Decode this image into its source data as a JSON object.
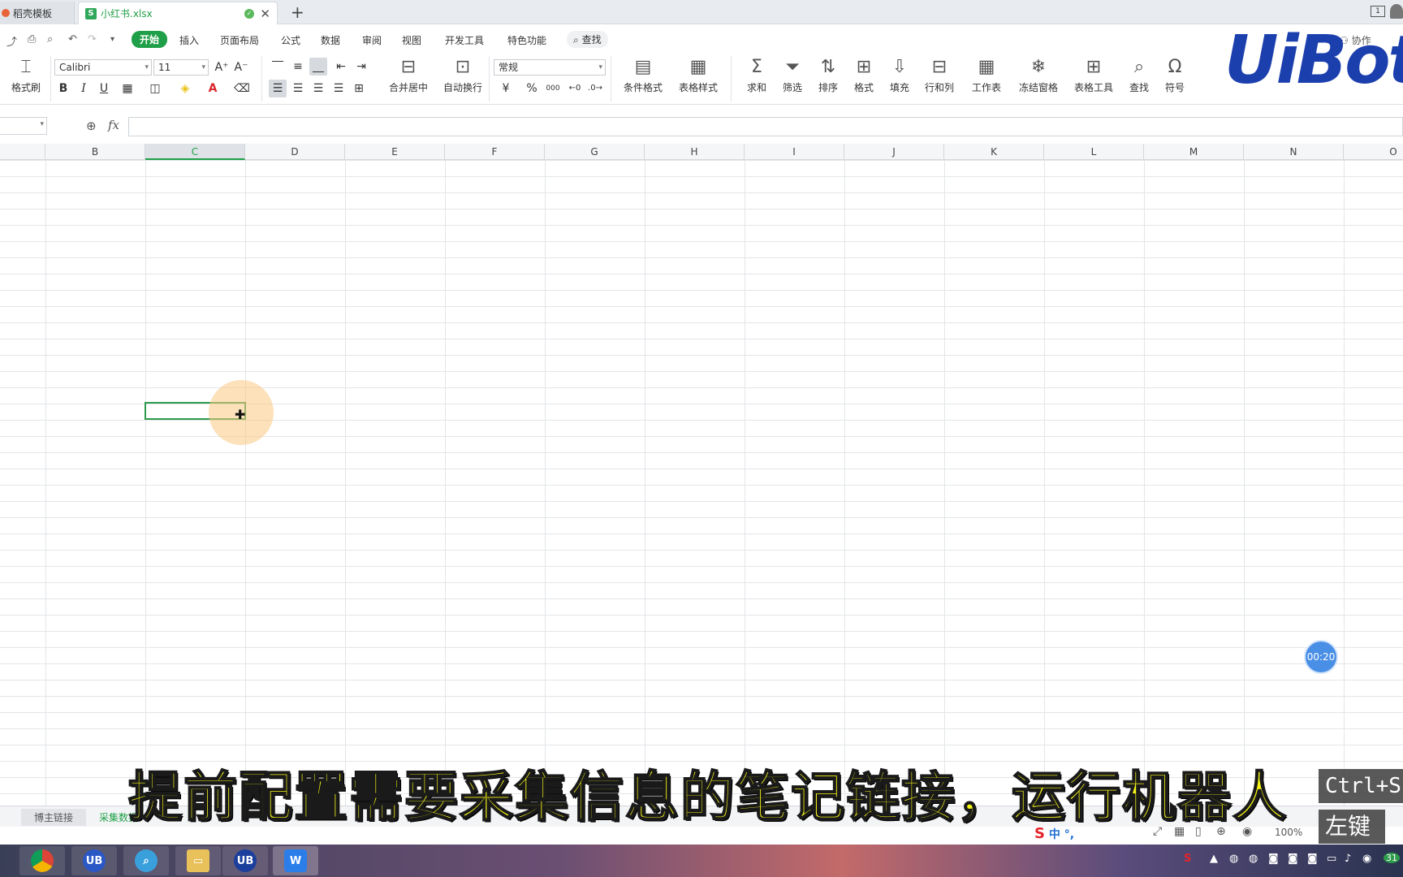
{
  "tabs": {
    "inactive_label": "稻壳模板",
    "active_label": "小红书.xlsx",
    "active_icon_letter": "S",
    "new_tab": "+"
  },
  "window": {
    "ctrl_label": "1"
  },
  "menu": {
    "items": [
      "开始",
      "插入",
      "页面布局",
      "公式",
      "数据",
      "审阅",
      "视图",
      "开发工具",
      "特色功能"
    ],
    "search_label": "查找",
    "collab_label": "协作"
  },
  "ribbon": {
    "format_painter": "格式刷",
    "font_name": "Calibri",
    "font_size": "11",
    "merge_center": "合并居中",
    "wrap_text": "自动换行",
    "number_format": "常规",
    "currency_symbol": "¥",
    "percent_symbol": "%",
    "thousands_symbol": "000",
    "cond_format": "条件格式",
    "table_style": "表格样式",
    "sum": "求和",
    "filter": "筛选",
    "sort": "排序",
    "format": "格式",
    "fill": "填充",
    "row_col": "行和列",
    "worksheet": "工作表",
    "freeze": "冻结窗格",
    "table_tools": "表格工具",
    "find": "查找",
    "symbol": "符号"
  },
  "logo": "UiBot",
  "formula": {
    "fx_label": "fx"
  },
  "columns": [
    "B",
    "C",
    "D",
    "E",
    "F",
    "G",
    "H",
    "I",
    "J",
    "K",
    "L",
    "M",
    "N",
    "O"
  ],
  "selected_column": "C",
  "timer": "00:20",
  "sheets": {
    "inactive": "博主链接",
    "active": "采集数据"
  },
  "status": {
    "zoom": "100%"
  },
  "subtitle": "提前配置需要采集信息的笔记链接，运行机器人",
  "keys": {
    "combo": "Ctrl+S",
    "mouse": "左键"
  },
  "ime": {
    "lang": "中"
  },
  "taskbar": {
    "apps": [
      "chrome-icon",
      "uibot-creator-icon",
      "search-tool-icon",
      "file-explorer-icon",
      "uibot-worker-icon",
      "wps-icon"
    ],
    "uibot_label": "UB",
    "wps_label": "W",
    "clock": "31"
  }
}
